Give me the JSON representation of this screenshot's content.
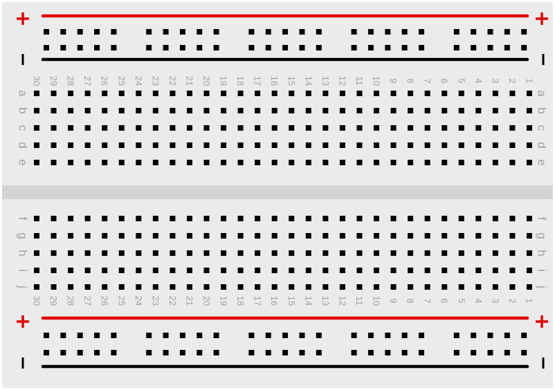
{
  "breadboard": {
    "rail_symbols": {
      "plus": "+",
      "minus": "-"
    },
    "row_labels_top": [
      "a",
      "b",
      "c",
      "d",
      "e"
    ],
    "row_labels_bottom": [
      "f",
      "g",
      "h",
      "i",
      "j"
    ],
    "column_numbers": [
      "30",
      "29",
      "28",
      "27",
      "26",
      "25",
      "24",
      "23",
      "22",
      "21",
      "20",
      "19",
      "18",
      "17",
      "16",
      "15",
      "14",
      "13",
      "12",
      "11",
      "10",
      "9",
      "8",
      "7",
      "6",
      "5",
      "4",
      "3",
      "2",
      "1"
    ],
    "columns": 30,
    "rail_hole_groups": 5,
    "holes_per_rail_group": 5,
    "colors": {
      "board": "#ebebeb",
      "channel": "#d3d3d3",
      "hole": "#000000",
      "positive_rail": "#e00000",
      "negative_rail": "#000000",
      "label": "#a0a0a0"
    }
  }
}
